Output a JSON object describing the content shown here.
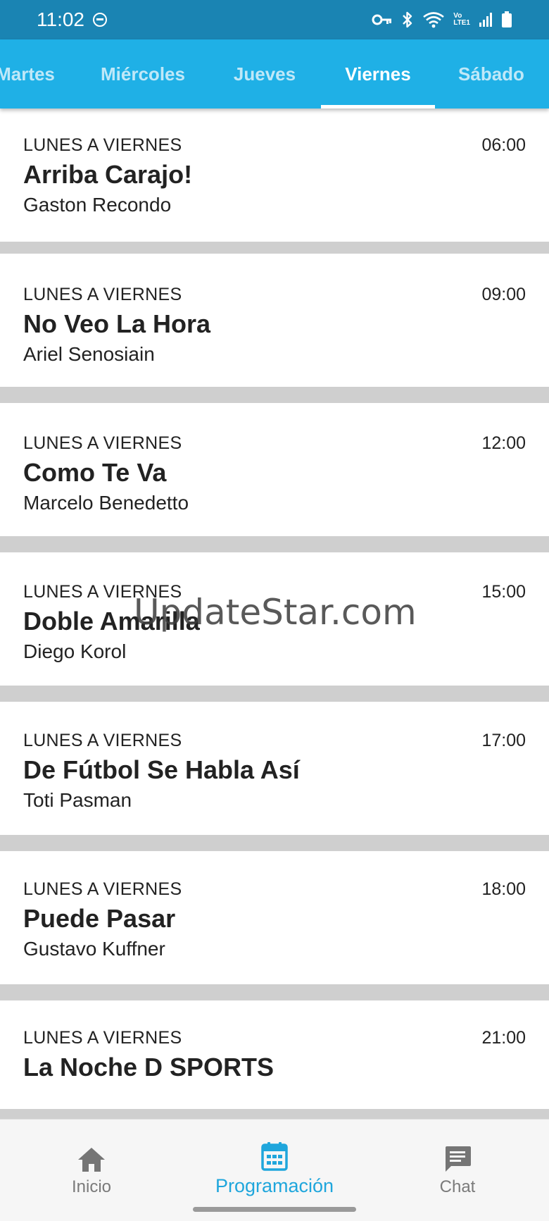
{
  "status_bar": {
    "time": "11:02",
    "icons": [
      "do-not-disturb-icon",
      "vpn-key-icon",
      "bluetooth-icon",
      "wifi-icon",
      "volte-icon",
      "signal-icon",
      "battery-icon"
    ],
    "volte_top": "Vo",
    "volte_bottom": "LTE1"
  },
  "tabs": [
    {
      "label": "Martes",
      "active": false
    },
    {
      "label": "Miércoles",
      "active": false
    },
    {
      "label": "Jueves",
      "active": false
    },
    {
      "label": "Viernes",
      "active": true
    },
    {
      "label": "Sábado",
      "active": false
    }
  ],
  "programs": [
    {
      "days": "LUNES A VIERNES",
      "time": "06:00",
      "title": "Arriba Carajo!",
      "host": "Gaston Recondo"
    },
    {
      "days": "LUNES A VIERNES",
      "time": "09:00",
      "title": "No Veo La Hora",
      "host": "Ariel Senosiain"
    },
    {
      "days": "LUNES A VIERNES",
      "time": "12:00",
      "title": "Como Te Va",
      "host": "Marcelo Benedetto"
    },
    {
      "days": "LUNES A VIERNES",
      "time": "15:00",
      "title": "Doble Amarilla",
      "host": "Diego Korol"
    },
    {
      "days": "LUNES A VIERNES",
      "time": "17:00",
      "title": "De Fútbol Se Habla Así",
      "host": "Toti Pasman"
    },
    {
      "days": "LUNES A VIERNES",
      "time": "18:00",
      "title": "Puede Pasar",
      "host": "Gustavo Kuffner"
    },
    {
      "days": "LUNES A VIERNES",
      "time": "21:00",
      "title": "La Noche D SPORTS",
      "host": ""
    }
  ],
  "watermark": "UpdateStar.com",
  "bottom_nav": [
    {
      "label": "Inicio",
      "icon": "home-icon",
      "active": false
    },
    {
      "label": "Programación",
      "icon": "calendar-icon",
      "active": true
    },
    {
      "label": "Chat",
      "icon": "chat-icon",
      "active": false
    }
  ],
  "colors": {
    "status_bar": "#1a84b3",
    "tab_bar": "#1fb0e6",
    "accent": "#1fa6dc",
    "divider": "#cfcfcf"
  }
}
